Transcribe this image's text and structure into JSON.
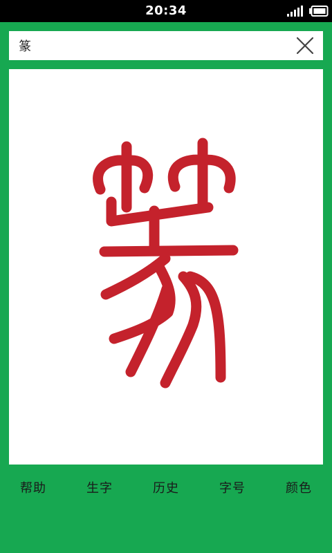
{
  "status_bar": {
    "time": "20:34",
    "signal_icon": "signal-bars-icon",
    "battery_icon": "battery-icon"
  },
  "search": {
    "value": "篆",
    "clear_icon": "close-icon"
  },
  "glyph": {
    "character": "篆",
    "style": "seal-script",
    "color": "#c4222c"
  },
  "bottom_nav": {
    "items": [
      {
        "label": "帮助"
      },
      {
        "label": "生字"
      },
      {
        "label": "历史"
      },
      {
        "label": "字号"
      },
      {
        "label": "颜色"
      }
    ]
  },
  "colors": {
    "background": "#17a851",
    "status_bar": "#000000",
    "panel": "#ffffff",
    "glyph": "#c4222c"
  }
}
